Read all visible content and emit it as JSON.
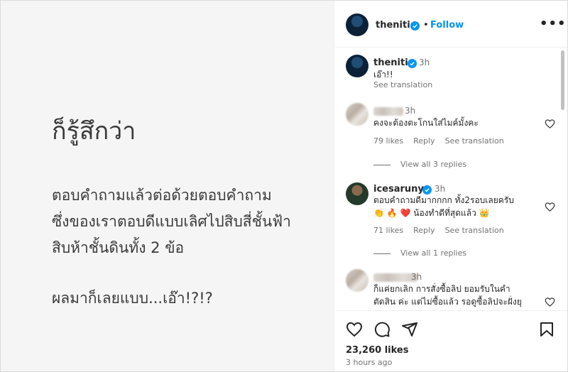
{
  "post_image": {
    "title": "ก็รู้สึกว่า",
    "paragraph_lines": [
      "ตอบคำถามแล้วต่อด้วยตอบคำถาม",
      "ซึ่งของเราตอบดีแบบเลิศไปสิบสี่ชั้นฟ้า",
      "สิบห้าชั้นดินทั้ง 2 ข้อ"
    ],
    "last_line": "ผลมาก็เลยแบบ...เอ๊า!?!?"
  },
  "header": {
    "username": "theniti",
    "separator": "•",
    "follow_label": "Follow",
    "more_label": "•••"
  },
  "caption": {
    "username": "theniti",
    "time": "3h",
    "text": "เอ๊า!!",
    "see_translation": "See translation"
  },
  "comments": [
    {
      "username_hidden": true,
      "time": "3h",
      "text_lines": [
        "คงจะต้องตะโกนใส่ไมค์มั้งคะ"
      ],
      "likes": "79 likes",
      "reply": "Reply",
      "see_translation": "See translation",
      "view_replies": "View all 3 replies"
    },
    {
      "username": "icesarunyu",
      "time": "3h",
      "text_lines": [
        "ตอบคำถามดีมากกกก ทั้ง2รอบเลยครับ",
        "👏 🔥 ❤️ น้องทำดีที่สุดแล้ว 👑"
      ],
      "likes": "71 likes",
      "reply": "Reply",
      "see_translation": "See translation",
      "view_replies": "View all 1 replies"
    },
    {
      "username_hidden": true,
      "time": "3h",
      "text_lines": [
        "ก็แค่ยกเลิก การสั่งซื้อลิป ยอมรับในคำ",
        "ตัดสิน ค่ะ แต่ไม่ซื้อแล้ว รอดูซื้อลิปจะฝั่งยุ"
      ]
    }
  ],
  "actions": {
    "likes_count": "23,260 likes",
    "posted_time": "3 hours ago"
  },
  "colors": {
    "accent": "#0095f6",
    "secondary_text": "#737373",
    "primary_text": "#262626"
  }
}
